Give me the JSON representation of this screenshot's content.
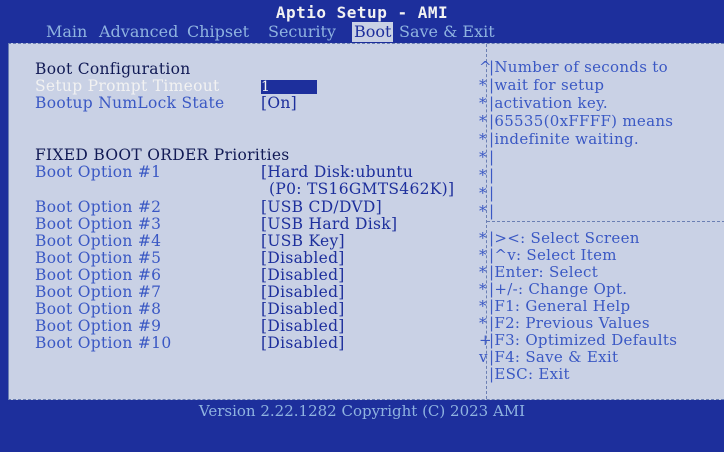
{
  "header": {
    "title": "Aptio Setup - AMI",
    "tabs": [
      {
        "label": "Main"
      },
      {
        "label": "Advanced"
      },
      {
        "label": "Chipset"
      },
      {
        "label": "Security"
      },
      {
        "label": "Boot"
      },
      {
        "label": "Save & Exit"
      }
    ],
    "active_tab": "Boot"
  },
  "settings": {
    "section_title": "Boot Configuration",
    "setup_prompt_timeout": {
      "label": "Setup Prompt Timeout",
      "value": "1"
    },
    "bootup_numlock": {
      "label": "Bootup NumLock State",
      "value": "[On]"
    },
    "fixed_order_title": "FIXED BOOT ORDER Priorities",
    "boot_options": [
      {
        "label": "Boot Option #1",
        "value": "[Hard Disk:ubuntu",
        "value2": "(P0: TS16GMTS462K)]"
      },
      {
        "label": "Boot Option #2",
        "value": "[USB CD/DVD]"
      },
      {
        "label": "Boot Option #3",
        "value": "[USB Hard Disk]"
      },
      {
        "label": "Boot Option #4",
        "value": "[USB Key]"
      },
      {
        "label": "Boot Option #5",
        "value": "[Disabled]"
      },
      {
        "label": "Boot Option #6",
        "value": "[Disabled]"
      },
      {
        "label": "Boot Option #7",
        "value": "[Disabled]"
      },
      {
        "label": "Boot Option #8",
        "value": "[Disabled]"
      },
      {
        "label": "Boot Option #9",
        "value": "[Disabled]"
      },
      {
        "label": "Boot Option #10",
        "value": "[Disabled]"
      }
    ]
  },
  "help": {
    "description": [
      "Number of seconds to",
      "wait for setup",
      "activation key.",
      "65535(0xFFFF) means",
      "indefinite waiting."
    ],
    "keys": [
      "><: Select Screen",
      "^v: Select Item",
      "Enter: Select",
      "+/-: Change Opt.",
      "F1: General Help",
      "F2: Previous Values",
      "F3: Optimized Defaults",
      "F4: Save & Exit",
      "ESC: Exit"
    ]
  },
  "footer": {
    "text": "Version 2.22.1282 Copyright (C) 2023 AMI"
  },
  "colors": {
    "frame_bg": "#1d2f9c",
    "panel_bg": "#c9d1e5",
    "item_text": "#3a58c4",
    "highlight_text": "#f2f2f2"
  }
}
